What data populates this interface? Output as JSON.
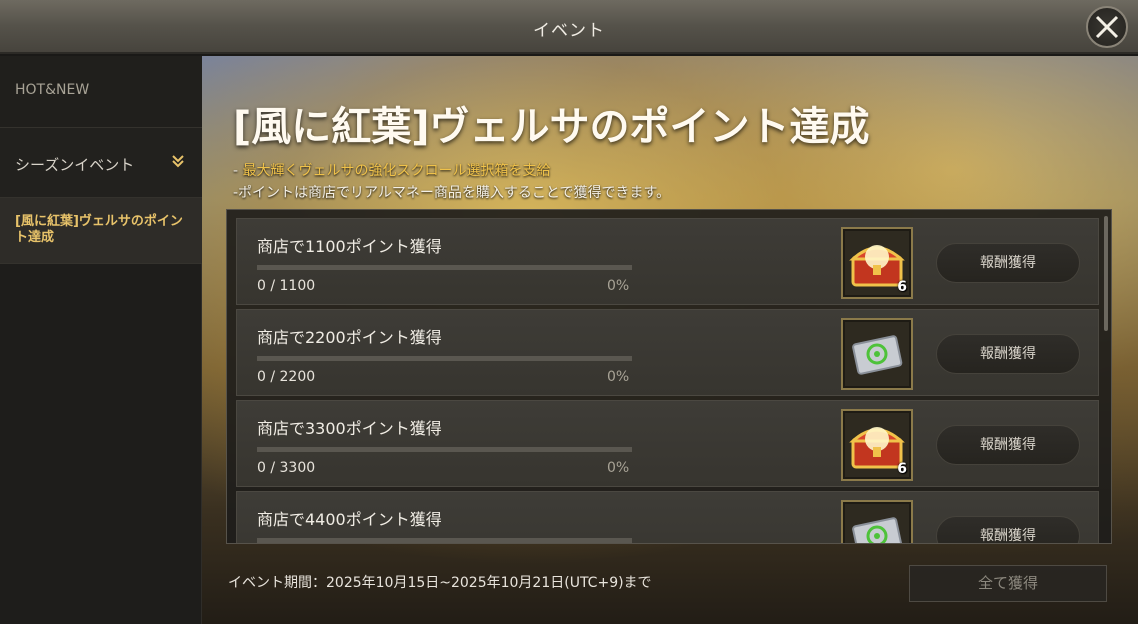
{
  "window": {
    "title": "イベント"
  },
  "sidebar": {
    "items": [
      {
        "label": "HOT&NEW"
      },
      {
        "label": "シーズンイベント"
      },
      {
        "label": "[風に紅葉]ヴェルサのポイント達成"
      }
    ]
  },
  "event": {
    "title": "[風に紅葉]ヴェルサのポイント達成",
    "desc_dash": "- ",
    "desc_highlight": "最大輝くヴェルサの強化スクロール選択箱を支給",
    "desc_note": "-ポイントは商店でリアルマネー商品を購入することで獲得できます。",
    "period": "イベント期間：2025年10月15日~2025年10月21日(UTC+9)まで",
    "claim_all_label": "全て獲得"
  },
  "missions": [
    {
      "label": "商店で1100ポイント獲得",
      "count": "0 / 1100",
      "percent": "0%",
      "progress": 0,
      "reward_icon": "treasure-chest-icon",
      "reward_qty": "6",
      "button": "報酬獲得"
    },
    {
      "label": "商店で2200ポイント獲得",
      "count": "0 / 2200",
      "percent": "0%",
      "progress": 0,
      "reward_icon": "scroll-ticket-icon",
      "reward_qty": "",
      "button": "報酬獲得"
    },
    {
      "label": "商店で3300ポイント獲得",
      "count": "0 / 3300",
      "percent": "0%",
      "progress": 0,
      "reward_icon": "treasure-chest-icon",
      "reward_qty": "6",
      "button": "報酬獲得"
    },
    {
      "label": "商店で4400ポイント獲得",
      "count": "",
      "percent": "",
      "progress": 0,
      "reward_icon": "scroll-ticket-icon",
      "reward_qty": "",
      "button": "報酬獲得"
    }
  ],
  "colors": {
    "accent": "#f0c24a",
    "active_sidebar": "#e8c36a",
    "panel": "#1e1d1b"
  }
}
